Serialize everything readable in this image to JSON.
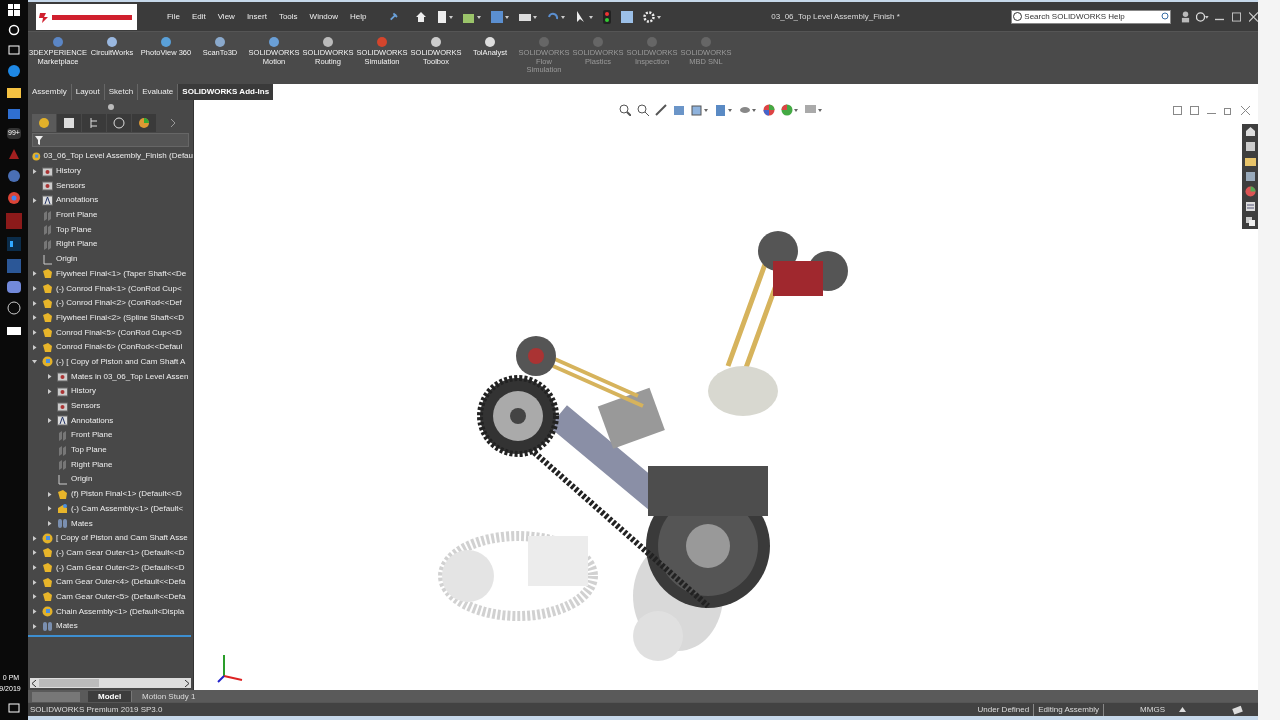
{
  "taskbar": {
    "time": "0 PM",
    "date": "9/2019",
    "badge": "99+"
  },
  "window": {
    "title": "03_06_Top Level Assembly_Finish *",
    "menu": [
      "File",
      "Edit",
      "View",
      "Insert",
      "Tools",
      "Window",
      "Help"
    ],
    "search": {
      "placeholder": "Search SOLIDWORKS Help"
    }
  },
  "commands": [
    {
      "label": "3DEXPERIENCE Marketplace",
      "disabled": false
    },
    {
      "label": "CircuitWorks",
      "disabled": false
    },
    {
      "label": "PhotoView 360",
      "disabled": false
    },
    {
      "label": "ScanTo3D",
      "disabled": false
    },
    {
      "label": "SOLIDWORKS Motion",
      "disabled": false
    },
    {
      "label": "SOLIDWORKS Routing",
      "disabled": false
    },
    {
      "label": "SOLIDWORKS Simulation",
      "disabled": false
    },
    {
      "label": "SOLIDWORKS Toolbox",
      "disabled": false
    },
    {
      "label": "TolAnalyst",
      "disabled": false
    },
    {
      "label": "SOLIDWORKS Flow Simulation",
      "disabled": true
    },
    {
      "label": "SOLIDWORKS Plastics",
      "disabled": true
    },
    {
      "label": "SOLIDWORKS Inspection",
      "disabled": true
    },
    {
      "label": "SOLIDWORKS MBD SNL",
      "disabled": true
    }
  ],
  "tabs": [
    {
      "label": "Assembly",
      "selected": false
    },
    {
      "label": "Layout",
      "selected": false
    },
    {
      "label": "Sketch",
      "selected": false
    },
    {
      "label": "Evaluate",
      "selected": false
    },
    {
      "label": "SOLIDWORKS Add-Ins",
      "selected": true
    }
  ],
  "tree": {
    "label": "03_06_Top Level Assembly_Finish  (Defau",
    "kind": "assembly",
    "children": [
      {
        "label": "History",
        "kind": "folder",
        "expandable": true,
        "expanded": false
      },
      {
        "label": "Sensors",
        "kind": "folder",
        "expandable": false
      },
      {
        "label": "Annotations",
        "kind": "annotation",
        "expandable": true,
        "expanded": false
      },
      {
        "label": "Front Plane",
        "kind": "plane",
        "expandable": false
      },
      {
        "label": "Top Plane",
        "kind": "plane",
        "expandable": false
      },
      {
        "label": "Right Plane",
        "kind": "plane",
        "expandable": false
      },
      {
        "label": "Origin",
        "kind": "origin",
        "expandable": false
      },
      {
        "label": "Flywheel Final<1>  (Taper Shaft<<De",
        "kind": "part",
        "expandable": true,
        "expanded": false
      },
      {
        "label": "(-) Conrod Final<1>  (ConRod Cup<",
        "kind": "part",
        "expandable": true,
        "expanded": false
      },
      {
        "label": "(-) Conrod Final<2>  (ConRod<<Def",
        "kind": "part",
        "expandable": true,
        "expanded": false
      },
      {
        "label": "Flywheel Final<2>  (Spline Shaft<<D",
        "kind": "part",
        "expandable": true,
        "expanded": false
      },
      {
        "label": "Conrod Final<5>  (ConRod Cup<<D",
        "kind": "part",
        "expandable": true,
        "expanded": false
      },
      {
        "label": "Conrod Final<6>  (ConRod<<Defaul",
        "kind": "part",
        "expandable": true,
        "expanded": false
      },
      {
        "label": "(-) [ Copy of Piston and Cam Shaft A",
        "kind": "assembly",
        "expandable": true,
        "expanded": true,
        "children": [
          {
            "label": "Mates in 03_06_Top Level Assen",
            "kind": "folder",
            "expandable": true,
            "expanded": false
          },
          {
            "label": "History",
            "kind": "folder",
            "expandable": true,
            "expanded": false
          },
          {
            "label": "Sensors",
            "kind": "folder",
            "expandable": false
          },
          {
            "label": "Annotations",
            "kind": "annotation",
            "expandable": true,
            "expanded": false
          },
          {
            "label": "Front Plane",
            "kind": "plane",
            "expandable": false
          },
          {
            "label": "Top Plane",
            "kind": "plane",
            "expandable": false
          },
          {
            "label": "Right Plane",
            "kind": "plane",
            "expandable": false
          },
          {
            "label": "Origin",
            "kind": "origin",
            "expandable": false
          },
          {
            "label": "(f) Piston Final<1>  (Default<<D",
            "kind": "part",
            "expandable": true,
            "expanded": false
          },
          {
            "label": "(-) Cam Assembly<1>  (Default<",
            "kind": "subassembly",
            "expandable": true,
            "expanded": false
          },
          {
            "label": "Mates",
            "kind": "mates",
            "expandable": true,
            "expanded": false
          }
        ]
      },
      {
        "label": "[ Copy of Piston and Cam Shaft Asse",
        "kind": "assembly",
        "expandable": true,
        "expanded": false
      },
      {
        "label": "(-) Cam Gear Outer<1>  (Default<<D",
        "kind": "part",
        "expandable": true,
        "expanded": false
      },
      {
        "label": "(-) Cam Gear Outer<2>  (Default<<D",
        "kind": "part",
        "expandable": true,
        "expanded": false
      },
      {
        "label": "Cam Gear Outer<4>  (Default<<Defa",
        "kind": "part",
        "expandable": true,
        "expanded": false
      },
      {
        "label": "Cam Gear Outer<5>  (Default<<Defa",
        "kind": "part",
        "expandable": true,
        "expanded": false
      },
      {
        "label": "Chain Assembly<1>  (Default<Displa",
        "kind": "assembly",
        "expandable": true,
        "expanded": false
      },
      {
        "label": "Mates",
        "kind": "mates",
        "expandable": true,
        "expanded": false
      }
    ]
  },
  "bottom_tabs": [
    {
      "label": "Model",
      "selected": true
    },
    {
      "label": "Motion Study 1",
      "selected": false
    }
  ],
  "status_bar": {
    "product": "SOLIDWORKS Premium 2019 SP3.0",
    "fields": [
      "Under Defined",
      "Editing Assembly",
      "MMGS"
    ]
  }
}
